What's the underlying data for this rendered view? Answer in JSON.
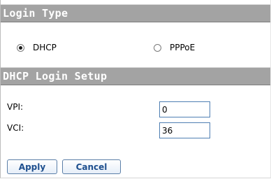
{
  "sections": {
    "login_type": {
      "title": "Login Type",
      "options": [
        {
          "label": "DHCP",
          "checked": true
        },
        {
          "label": "PPPoE",
          "checked": false
        }
      ]
    },
    "dhcp_setup": {
      "title": "DHCP Login Setup",
      "fields": [
        {
          "label": "VPI:",
          "value": "0"
        },
        {
          "label": "VCI:",
          "value": "36"
        }
      ]
    }
  },
  "buttons": {
    "apply": "Apply",
    "cancel": "Cancel"
  }
}
